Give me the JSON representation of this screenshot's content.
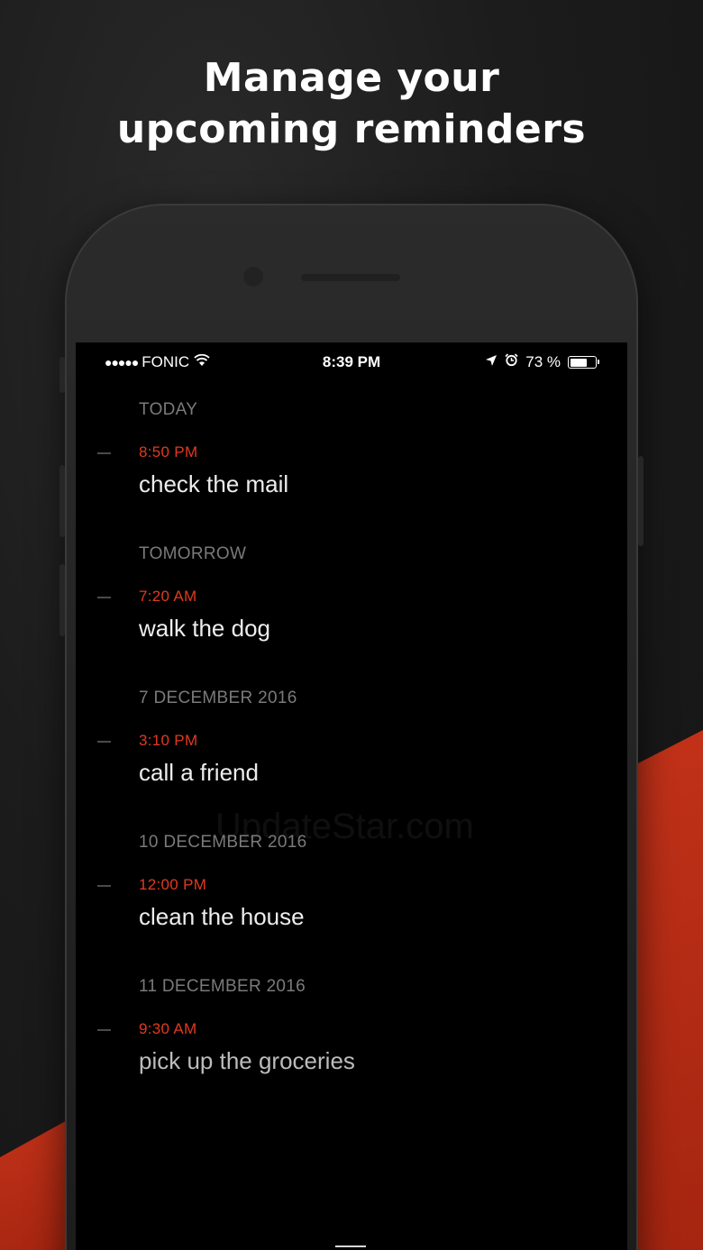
{
  "headline": {
    "line1": "Manage your",
    "line2": "upcoming reminders"
  },
  "status_bar": {
    "signal": "●●●●●",
    "carrier": "FONIC",
    "wifi_icon": "wifi-icon",
    "time": "8:39 PM",
    "location_icon": "location-arrow-icon",
    "alarm_icon": "alarm-clock-icon",
    "battery_percent_label": "73 %",
    "battery_level": 0.73
  },
  "groups": [
    {
      "heading": "TODAY",
      "reminders": [
        {
          "time": "8:50 PM",
          "title": "check the mail"
        }
      ]
    },
    {
      "heading": "TOMORROW",
      "reminders": [
        {
          "time": "7:20 AM",
          "title": "walk the dog"
        }
      ]
    },
    {
      "heading": "7 DECEMBER 2016",
      "reminders": [
        {
          "time": "3:10 PM",
          "title": "call a friend"
        }
      ]
    },
    {
      "heading": "10 DECEMBER 2016",
      "reminders": [
        {
          "time": "12:00 PM",
          "title": "clean the house"
        }
      ]
    },
    {
      "heading": "11 DECEMBER 2016",
      "reminders": [
        {
          "time": "9:30 AM",
          "title": "pick up the groceries"
        }
      ]
    }
  ],
  "watermark": "UpdateStar.com",
  "menu_icon": "hamburger-menu-icon",
  "colors": {
    "accent_red": "#e03a21",
    "background_red": "#c23219",
    "heading_gray": "#7a7a7a"
  }
}
